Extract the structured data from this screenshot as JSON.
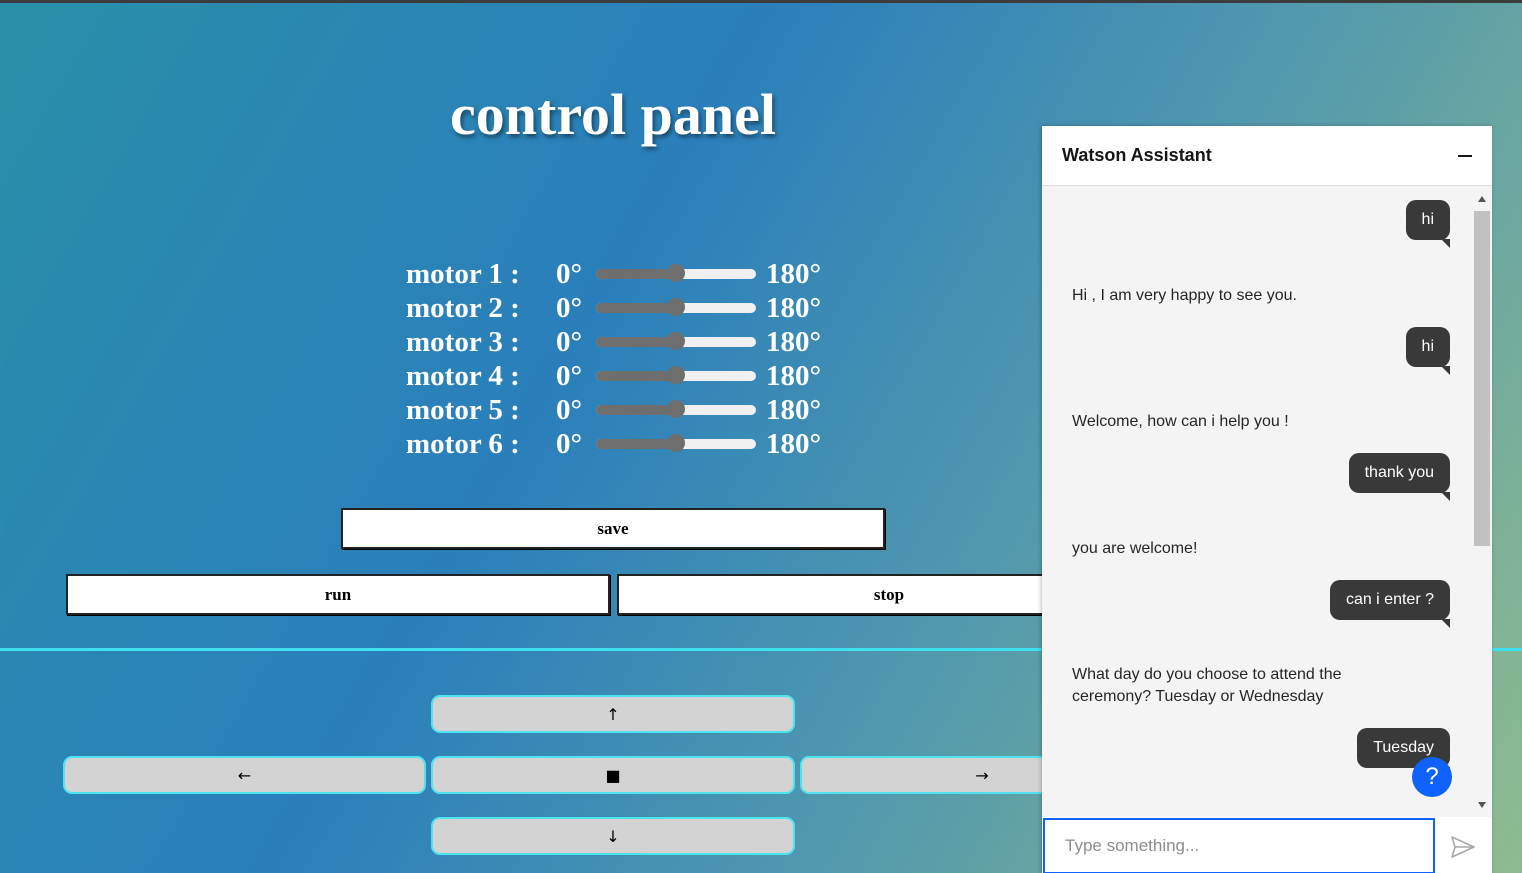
{
  "title": "control panel",
  "motors": [
    {
      "label": "motor 1 :",
      "min": "0°",
      "max": "180°",
      "value": 0.5
    },
    {
      "label": "motor 2 :",
      "min": "0°",
      "max": "180°",
      "value": 0.5
    },
    {
      "label": "motor 3 :",
      "min": "0°",
      "max": "180°",
      "value": 0.5
    },
    {
      "label": "motor 4 :",
      "min": "0°",
      "max": "180°",
      "value": 0.5
    },
    {
      "label": "motor 5 :",
      "min": "0°",
      "max": "180°",
      "value": 0.5
    },
    {
      "label": "motor 6 :",
      "min": "0°",
      "max": "180°",
      "value": 0.5
    }
  ],
  "buttons": {
    "save": "save",
    "run": "run",
    "stop": "stop"
  },
  "nav": {
    "up": "↑",
    "left": "←",
    "stop": "■",
    "right": "→",
    "down": "↓"
  },
  "chat": {
    "title": "Watson Assistant",
    "messages": [
      {
        "from": "user",
        "text": "hi"
      },
      {
        "from": "bot",
        "text": "Hi , I am very happy to see you."
      },
      {
        "from": "user",
        "text": "hi"
      },
      {
        "from": "bot",
        "text": "Welcome, how can i help you !"
      },
      {
        "from": "user",
        "text": "thank you"
      },
      {
        "from": "bot",
        "text": "you are welcome!"
      },
      {
        "from": "user",
        "text": "can i enter ?"
      },
      {
        "from": "bot",
        "text": "What day do you choose to attend the ceremony? Tuesday or Wednesday"
      },
      {
        "from": "user",
        "text": "Tuesday"
      }
    ],
    "help": "?",
    "placeholder": "Type something..."
  },
  "colors": {
    "accent": "#0f62fe",
    "divider": "#3fe0ee",
    "bubble": "#393939"
  }
}
